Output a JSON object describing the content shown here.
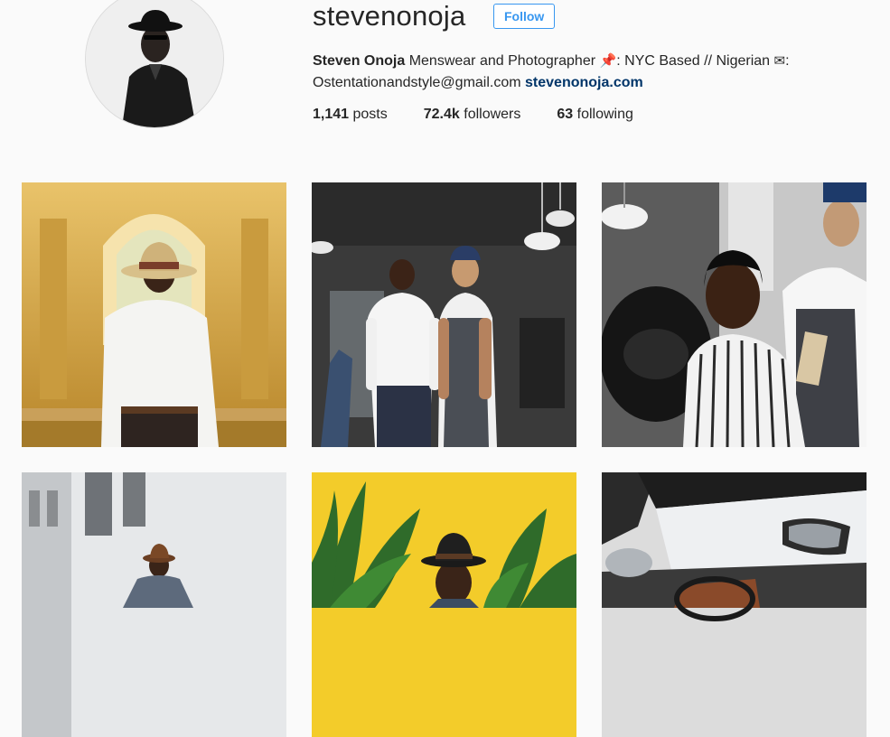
{
  "profile": {
    "username": "stevenonoja",
    "follow_label": "Follow",
    "full_name": "Steven Onoja",
    "bio_line1": "Menswear and Photographer",
    "bio_location": ": NYC Based // Nigerian",
    "bio_email": "Ostentationandstyle@gmail.com",
    "bio_link": "stevenonoja.com",
    "pin_icon": "pushpin-icon",
    "mail_icon": "envelope-icon",
    "avatar_icon": "avatar"
  },
  "stats": {
    "posts_count": "1,141",
    "posts_label": "posts",
    "followers_count": "72.4k",
    "followers_label": "followers",
    "following_count": "63",
    "following_label": "following"
  },
  "posts": [
    {
      "subject": "man in straw hat at museum staircase"
    },
    {
      "subject": "two men in barbershop"
    },
    {
      "subject": "man getting haircut"
    },
    {
      "subject": "man in brown hat by white wall"
    },
    {
      "subject": "man in hat among plants on yellow wall"
    },
    {
      "subject": "vintage car interior"
    }
  ]
}
